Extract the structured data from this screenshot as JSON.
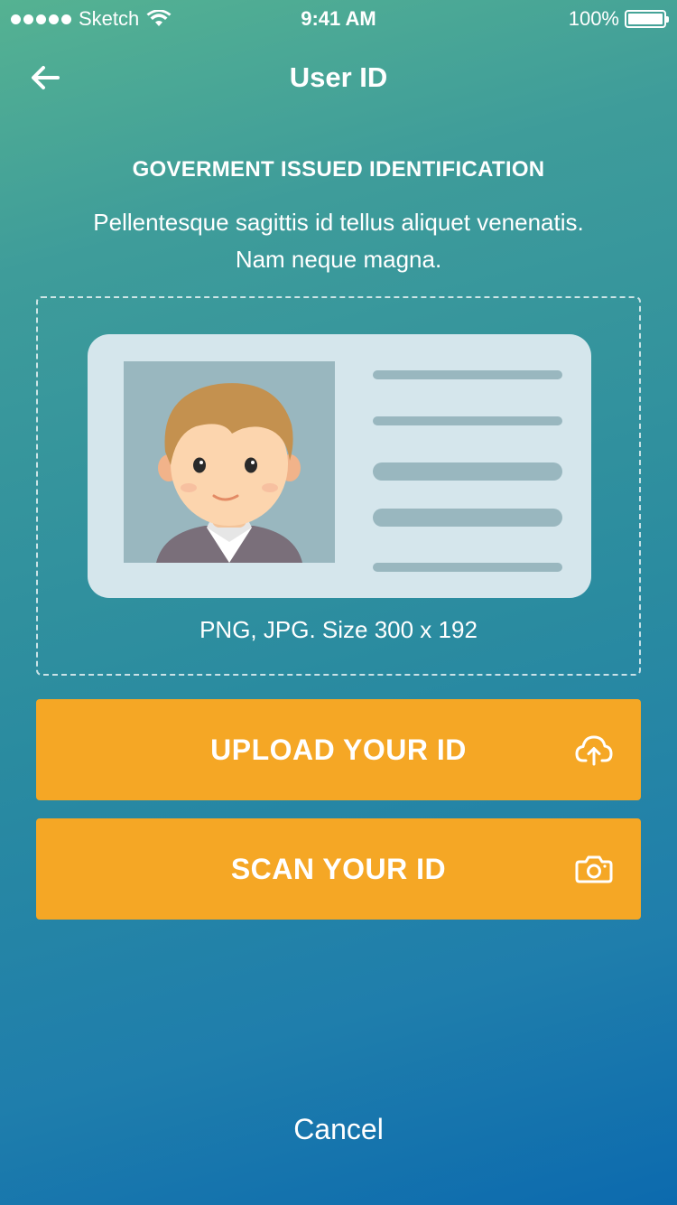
{
  "status_bar": {
    "carrier": "Sketch",
    "time": "9:41 AM",
    "battery": "100%"
  },
  "nav": {
    "title": "User ID",
    "back_icon": "arrow-left-icon"
  },
  "content": {
    "title": "GOVERMENT ISSUED IDENTIFICATION",
    "description": "Pellentesque sagittis id tellus aliquet venenatis. Nam neque magna.",
    "file_info": "PNG, JPG. Size 300 x 192"
  },
  "actions": {
    "upload_label": "UPLOAD YOUR ID",
    "upload_icon": "cloud-upload-icon",
    "scan_label": "SCAN YOUR ID",
    "scan_icon": "camera-icon"
  },
  "cancel_label": "Cancel",
  "colors": {
    "accent": "#f5a725",
    "card": "#d5e6ec",
    "card_detail": "#99b7bf",
    "gradient_top": "#55b292",
    "gradient_bottom": "#0c6aae"
  }
}
